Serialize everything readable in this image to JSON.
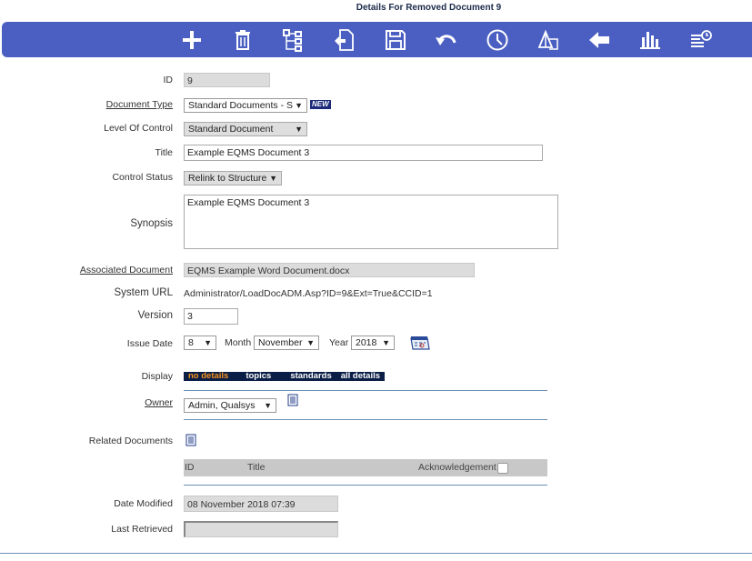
{
  "page": {
    "title": "Details For Removed Document 9"
  },
  "toolbar": {
    "buttons": [
      {
        "name": "add-button",
        "icon": "plus-icon"
      },
      {
        "name": "delete-button",
        "icon": "trash-icon"
      },
      {
        "name": "structure-button",
        "icon": "hierarchy-icon"
      },
      {
        "name": "relink-button",
        "icon": "document-link-icon"
      },
      {
        "name": "save-button",
        "icon": "save-icon"
      },
      {
        "name": "undo-button",
        "icon": "undo-icon"
      },
      {
        "name": "history-button",
        "icon": "clock-icon"
      },
      {
        "name": "compare-button",
        "icon": "compare-icon"
      },
      {
        "name": "back-button",
        "icon": "arrow-left-icon"
      },
      {
        "name": "report-button",
        "icon": "bar-chart-icon"
      },
      {
        "name": "audit-button",
        "icon": "list-history-icon"
      }
    ]
  },
  "form": {
    "id": {
      "label": "ID",
      "value": "9"
    },
    "document_type": {
      "label": "Document Type",
      "value": "Standard Documents - S",
      "badge": "NEW"
    },
    "level_of_control": {
      "label": "Level Of Control",
      "value": "Standard Document"
    },
    "title": {
      "label": "Title",
      "value": "Example EQMS Document 3"
    },
    "control_status": {
      "label": "Control Status",
      "value": "Relink to Structure"
    },
    "synopsis": {
      "label": "Synopsis",
      "value": "Example EQMS Document 3"
    },
    "associated_document": {
      "label": "Associated Document",
      "value": "EQMS Example Word Document.docx"
    },
    "system_url": {
      "label": "System URL",
      "value": "Administrator/LoadDocADM.Asp?ID=9&Ext=True&CCID=1"
    },
    "version": {
      "label": "Version",
      "value": "3"
    },
    "issue_date": {
      "label": "Issue Date",
      "day": "8",
      "month_label": "Month",
      "month": "November",
      "year_label": "Year",
      "year": "2018"
    },
    "display": {
      "label": "Display",
      "options": [
        "no details",
        "topics",
        "standards",
        "all details"
      ]
    },
    "owner": {
      "label": "Owner",
      "value": "Admin, Qualsys"
    },
    "related_documents": {
      "label": "Related Documents",
      "columns": [
        "ID",
        "Title",
        "Acknowledgement"
      ]
    },
    "date_modified": {
      "label": "Date Modified",
      "value": "08 November 2018 07:39"
    },
    "last_retrieved": {
      "label": "Last Retrieved",
      "value": ""
    }
  },
  "colors": {
    "toolbar": "#4a5fc1",
    "display_bar": "#0b1e46",
    "display_active": "#f7931e"
  }
}
